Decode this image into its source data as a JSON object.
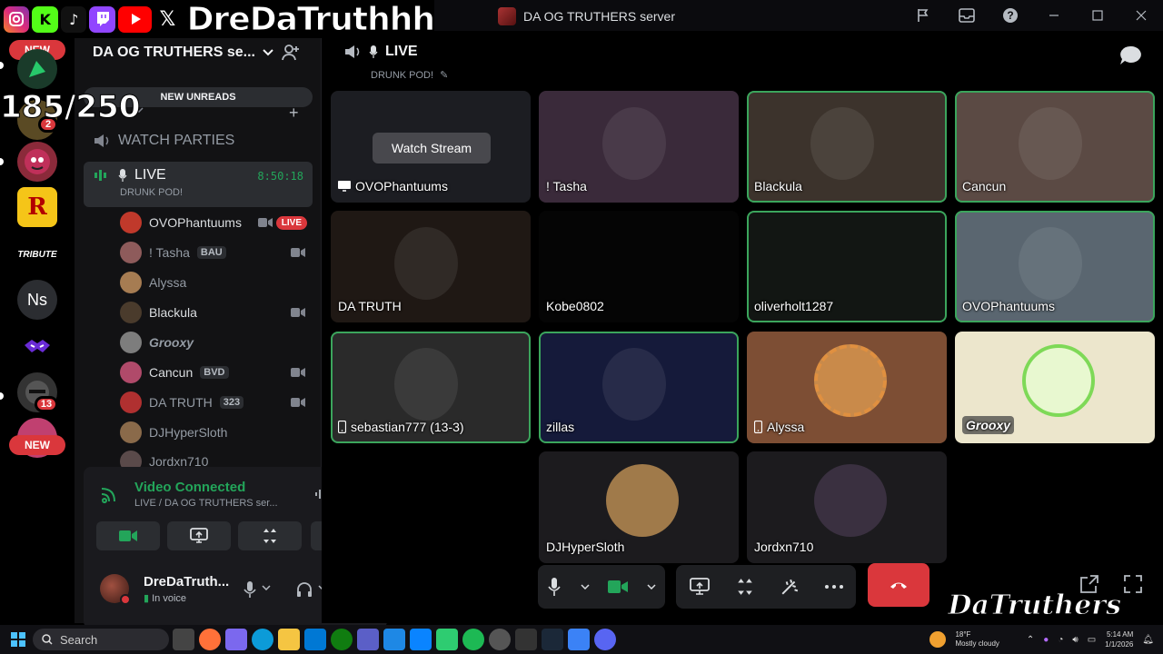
{
  "window": {
    "title": "DA OG TRUTHERS server"
  },
  "overlay": {
    "handle": "DreDaTruthhh",
    "counter": "185/250",
    "watermark": "DaTruthers",
    "socials": [
      {
        "name": "instagram-icon",
        "color": "#d62976"
      },
      {
        "name": "kick-icon",
        "color": "#53fc18"
      },
      {
        "name": "tiktok-icon",
        "color": "#111111"
      },
      {
        "name": "twitch-icon",
        "color": "#9146ff"
      },
      {
        "name": "youtube-icon",
        "color": "#ff0000"
      },
      {
        "name": "x-icon",
        "color": "#000000"
      }
    ]
  },
  "guilds": {
    "new_top": "NEW",
    "new_bottom": "NEW",
    "badge_mid": "2",
    "badge_bottom": "13",
    "ns": "Ns",
    "tribute": "TRIBUTE",
    "r_star": "R"
  },
  "sidebar": {
    "server_name": "DA OG TRUTHERS se...",
    "new_unreads": "NEW UNREADS",
    "watch_parties": "WATCH PARTIES",
    "live_channel": {
      "name": "LIVE",
      "timer": "8:50:18",
      "topic": "DRUNK POD!"
    },
    "members": [
      {
        "name": "OVOPhantuums",
        "badge": "LIVE",
        "color": "#c0392b"
      },
      {
        "name": "! Tasha",
        "tag": "BAU",
        "color": "#8e5b5b"
      },
      {
        "name": "Alyssa",
        "color": "#a67c52"
      },
      {
        "name": "Blackula",
        "color": "#4a3b2c"
      },
      {
        "name": "Grooxy",
        "color": "#7d7d7d"
      },
      {
        "name": "Cancun",
        "tag": "BVD",
        "color": "#b04a6a"
      },
      {
        "name": "DA TRUTH",
        "tag": "323",
        "color": "#b03030"
      },
      {
        "name": "DJHyperSloth",
        "color": "#8a6a4a"
      },
      {
        "name": "Jordxn710",
        "color": "#5a4a4a"
      }
    ]
  },
  "voice": {
    "status": "Video Connected",
    "location": "LIVE / DA OG TRUTHERS ser...",
    "user_name": "DreDaTruth...",
    "user_status": "In voice"
  },
  "stage": {
    "channel": "LIVE",
    "topic": "DRUNK POD!",
    "watch_stream": "Watch Stream",
    "tiles": [
      {
        "label": "OVOPhantuums",
        "icon": "screen",
        "bg": "#1c1d22"
      },
      {
        "label": "! Tasha",
        "bg": "#3a2a3a"
      },
      {
        "label": "Blackula",
        "bg": "#3c332c",
        "speaking": true
      },
      {
        "label": "Cancun",
        "bg": "#5b4a44",
        "speaking": true
      },
      {
        "label": "DA TRUTH",
        "bg": "#1f1814"
      },
      {
        "label": "Kobe0802",
        "bg": "#050505"
      },
      {
        "label": "oliverholt1287",
        "bg": "#121613",
        "speaking": true
      },
      {
        "label": "OVOPhantuums",
        "bg": "#5a6670",
        "speaking": true
      },
      {
        "label": "sebastian777 (13-3)",
        "icon": "phone",
        "bg": "#2a2a2a",
        "speaking": true
      },
      {
        "label": "zillas",
        "bg": "#151a3a",
        "speaking": true
      },
      {
        "label": "Alyssa",
        "icon": "phone",
        "bg": "#7d4e34"
      },
      {
        "label": "Grooxy",
        "bg": "#ece6cc",
        "tag": true
      },
      {
        "label": "DJHyperSloth",
        "bg": "#1c1b1e"
      },
      {
        "label": "Jordxn710",
        "bg": "#1c1b1e"
      }
    ]
  },
  "taskbar": {
    "search": "Search",
    "temp": "18°F",
    "weather": "Mostly cloudy",
    "time": "5:14 AM",
    "date": "1/1/2026"
  }
}
